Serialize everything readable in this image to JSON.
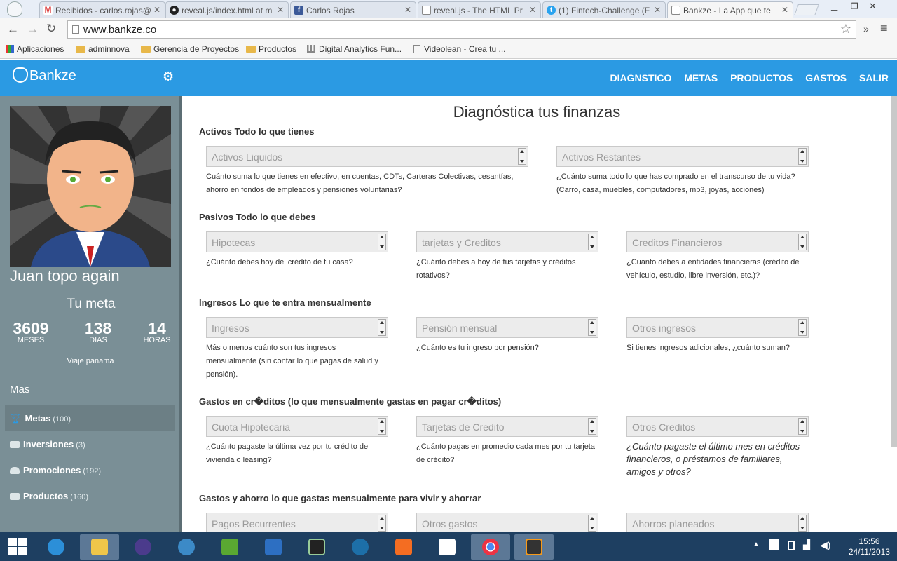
{
  "browser": {
    "tabs": [
      {
        "label": "Recibidos - carlos.rojas@",
        "icon": "gmail-icon"
      },
      {
        "label": "reveal.js/index.html at m",
        "icon": "github-icon"
      },
      {
        "label": "Carlos Rojas",
        "icon": "facebook-icon"
      },
      {
        "label": "reveal.js - The HTML Pr",
        "icon": "page-icon"
      },
      {
        "label": "(1) Fintech-Challenge (F",
        "icon": "twitter-icon"
      },
      {
        "label": "Bankze - La App que te",
        "icon": "page-icon"
      }
    ],
    "url": "www.bankze.co",
    "bookmarks": [
      {
        "label": "Aplicaciones",
        "icon": "apps-icon"
      },
      {
        "label": "adminnova",
        "icon": "folder-icon"
      },
      {
        "label": "Gerencia de Proyectos",
        "icon": "folder-icon"
      },
      {
        "label": "Productos",
        "icon": "folder-icon"
      },
      {
        "label": "Digital Analytics Fun...",
        "icon": "analytics-icon"
      },
      {
        "label": "Videolean - Crea tu ...",
        "icon": "page-icon"
      }
    ]
  },
  "header": {
    "logo": "Bankze",
    "nav": [
      "DIAGNSTICO",
      "METAS",
      "PRODUCTOS",
      "GASTOS",
      "SALIR"
    ]
  },
  "sidebar": {
    "user_name": "Juan topo again",
    "goal_heading": "Tu meta",
    "counters": [
      {
        "value": "3609",
        "label": "MESES"
      },
      {
        "value": "138",
        "label": "DIAS"
      },
      {
        "value": "14",
        "label": "HORAS"
      }
    ],
    "goal_name": "Viaje panama",
    "more_heading": "Mas",
    "items": [
      {
        "label": "Metas",
        "count": "(100)",
        "icon": "trophy-icon"
      },
      {
        "label": "Inversiones",
        "count": "(3)",
        "icon": "briefcase-icon"
      },
      {
        "label": "Promociones",
        "count": "(192)",
        "icon": "users-icon"
      },
      {
        "label": "Productos",
        "count": "(160)",
        "icon": "box-icon"
      }
    ]
  },
  "main": {
    "title": "Diagnóstica tus finanzas",
    "sections": [
      {
        "heading": "Activos Todo lo que tienes",
        "fields": [
          {
            "placeholder": "Activos Liquidos",
            "help": "Cuánto suma lo que tienes en efectivo, en cuentas, CDTs, Carteras Colectivas, cesantías, ahorro en fondos de empleados y pensiones voluntarias?"
          },
          {
            "placeholder": "Activos Restantes",
            "help": "¿Cuánto suma todo lo que has comprado en el transcurso de tu vida? (Carro, casa, muebles, computadores, mp3, joyas, acciones)"
          }
        ]
      },
      {
        "heading": "Pasivos Todo lo que debes",
        "fields": [
          {
            "placeholder": "Hipotecas",
            "help": "¿Cuánto debes hoy del crédito de tu casa?"
          },
          {
            "placeholder": "tarjetas y Creditos",
            "help": "¿Cuánto debes a hoy de tus tarjetas y créditos rotativos?"
          },
          {
            "placeholder": "Creditos Financieros",
            "help": "¿Cuánto debes a entidades financieras (crédito de vehículo, estudio, libre inversión, etc.)?"
          }
        ]
      },
      {
        "heading": "Ingresos Lo que te entra mensualmente",
        "fields": [
          {
            "placeholder": "Ingresos",
            "help": "Más o menos cuánto son tus ingresos mensualmente (sin contar lo que pagas de salud y pensión)."
          },
          {
            "placeholder": "Pensión mensual",
            "help": "¿Cuánto es tu ingreso por pensión?"
          },
          {
            "placeholder": "Otros ingresos",
            "help": "Si tienes ingresos adicionales, ¿cuánto suman?"
          }
        ]
      },
      {
        "heading": "Gastos en cr�ditos (lo que mensualmente gastas en pagar cr�ditos)",
        "fields": [
          {
            "placeholder": "Cuota Hipotecaria",
            "help": "¿Cuánto pagaste la última vez por tu crédito de vivienda o leasing?"
          },
          {
            "placeholder": "Tarjetas de Credito",
            "help": "¿Cuánto pagas en promedio cada mes por tu tarjeta de crédito?"
          },
          {
            "placeholder": "Otros Creditos",
            "help": "¿Cuánto pagaste el último mes en créditos financieros, o préstamos de familiares, amigos y otros?"
          }
        ]
      },
      {
        "heading": "Gastos y ahorro lo que gastas mensualmente para vivir y ahorrar",
        "fields": [
          {
            "placeholder": "Pagos Recurrentes",
            "help": ""
          },
          {
            "placeholder": "Otros gastos",
            "help": ""
          },
          {
            "placeholder": "Ahorros planeados",
            "help": ""
          }
        ]
      }
    ]
  },
  "taskbar": {
    "time": "15:56",
    "date": "24/11/2013"
  },
  "colors": {
    "accent": "#2b9ae3",
    "sidebar": "#7a8f96",
    "taskbar": "#1e3f61"
  }
}
